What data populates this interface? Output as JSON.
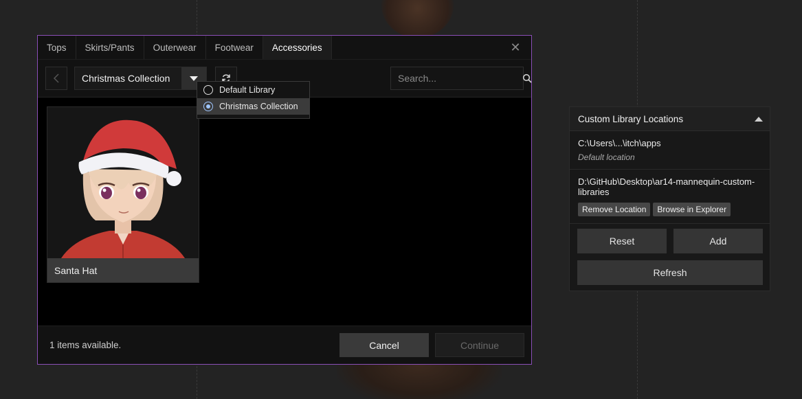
{
  "tabs": [
    {
      "label": "Tops"
    },
    {
      "label": "Skirts/Pants"
    },
    {
      "label": "Outerwear"
    },
    {
      "label": "Footwear"
    },
    {
      "label": "Accessories",
      "active": true
    }
  ],
  "toolbar": {
    "selected_library": "Christmas Collection",
    "search_placeholder": "Search..."
  },
  "dropdown": {
    "options": [
      {
        "label": "Default Library",
        "selected": false
      },
      {
        "label": "Christmas Collection",
        "selected": true
      }
    ]
  },
  "items": [
    {
      "label": "Santa Hat"
    }
  ],
  "footer": {
    "status": "1 items available.",
    "cancel_label": "Cancel",
    "continue_label": "Continue"
  },
  "panel": {
    "title": "Custom Library Locations",
    "locations": [
      {
        "path": "C:\\Users\\...\\itch\\apps",
        "note": "Default location"
      },
      {
        "path": "D:\\GitHub\\Desktop\\ar14-mannequin-custom-libraries",
        "actions": [
          "Remove Location",
          "Browse in Explorer"
        ]
      }
    ],
    "reset_label": "Reset",
    "add_label": "Add",
    "refresh_label": "Refresh"
  },
  "colors": {
    "dialog_border": "#8b4fb8",
    "radio_selected": "#9fc6ff",
    "background": "#232323"
  },
  "icons": [
    "close-icon",
    "chevron-left-icon",
    "chevron-down-icon",
    "refresh-icon",
    "search-icon",
    "collapse-up-icon"
  ]
}
